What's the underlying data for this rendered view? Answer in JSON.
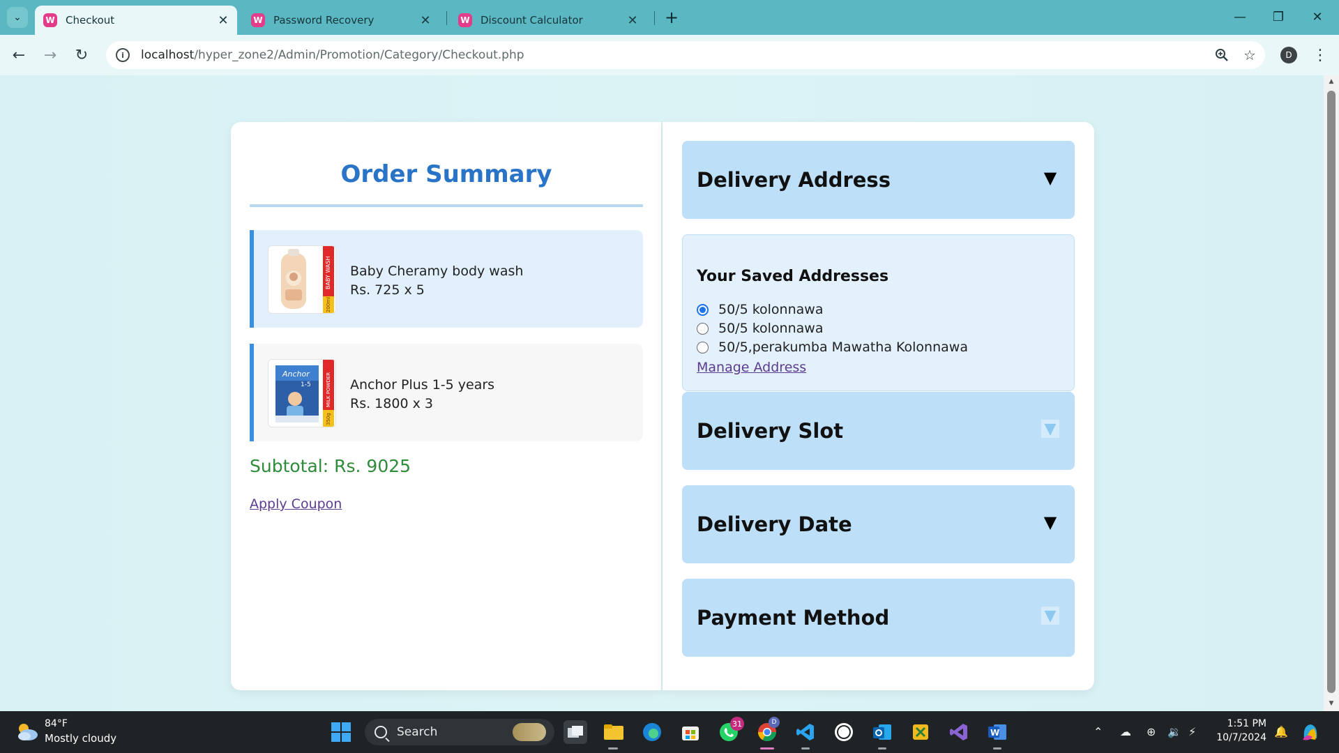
{
  "browser": {
    "tabs": [
      {
        "title": "Checkout",
        "active": true
      },
      {
        "title": "Password Recovery",
        "active": false
      },
      {
        "title": "Discount Calculator",
        "active": false
      }
    ],
    "favicon_letter": "W",
    "address": {
      "host": "localhost",
      "path": "/hyper_zone2/Admin/Promotion/Category/Checkout.php"
    },
    "profile_initial": "D"
  },
  "order_summary": {
    "title": "Order Summary",
    "items": [
      {
        "name": "Baby Cheramy body wash",
        "price_line": "Rs. 725 x 5",
        "label_text": "BABY WASH",
        "size_text": "200ml"
      },
      {
        "name": "Anchor Plus 1-5 years",
        "price_line": "Rs. 1800 x 3",
        "label_text": "MILK POWDER",
        "size_text": "350g",
        "pack_brand": "Anchor",
        "pack_sub": "1-5"
      }
    ],
    "subtotal": "Subtotal: Rs. 9025",
    "coupon_link": "Apply Coupon"
  },
  "checkout": {
    "sections": {
      "delivery_address": "Delivery Address",
      "delivery_slot": "Delivery Slot",
      "delivery_date": "Delivery Date",
      "payment_method": "Payment Method"
    },
    "saved_addresses_heading": "Your Saved Addresses",
    "addresses": [
      {
        "label": "50/5 kolonnawa",
        "selected": true
      },
      {
        "label": "50/5 kolonnawa",
        "selected": false
      },
      {
        "label": "50/5,perakumba Mawatha Kolonnawa",
        "selected": false
      }
    ],
    "manage_link": "Manage Address"
  },
  "taskbar": {
    "weather": {
      "temp": "84°F",
      "desc": "Mostly cloudy"
    },
    "search_placeholder": "Search",
    "whatsapp_badge": "31",
    "chrome_badge": "D",
    "clock": {
      "time": "1:51 PM",
      "date": "10/7/2024"
    }
  },
  "colors": {
    "accent_blue": "#2a74c7",
    "accordion_bg": "#bddff8",
    "subtotal_green": "#2e8b3a",
    "link_purple": "#5c3b8f"
  }
}
